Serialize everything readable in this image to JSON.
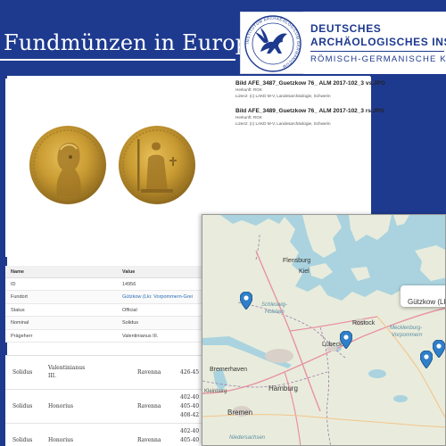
{
  "header": {
    "title": "Fundmünzen in Europa",
    "institute_line1": "DEUTSCHES",
    "institute_line2": "ARCHÄOLOGISCHES INSTITUT",
    "institute_line3": "RÖMISCH-GERMANISCHE KO",
    "seal_text": "INSTITUTUM ARCHAEOLOGICUM GERMANICUM"
  },
  "colors": {
    "brand_blue": "#1e3a8f",
    "link_blue": "#2a6db5",
    "map_water": "#aad3df",
    "map_land": "#e9ecdc",
    "marker_blue": "#2f7fc9"
  },
  "images": [
    {
      "filename": "Bild AFE_3487_Guetzkow 76_ ALM 2017-102_3 vs.JPG",
      "herkunft": "Herkunft: RGK",
      "lizenz": "Lizenz: (c) LAKD M-V, Landesarchäologie, Schwerin"
    },
    {
      "filename": "Bild AFE_3489_Guetzkow 76_ ALM 2017-102_3 rs.JPG",
      "herkunft": "Herkunft: RGK",
      "lizenz": "Lizenz: (c) LAKD M-V, Landesarchäologie, Schwerin"
    }
  ],
  "attributes": {
    "col_name": "Name",
    "col_value": "Value",
    "rows": [
      {
        "key": "ID",
        "value": "14956"
      },
      {
        "key": "Fundort",
        "value": "Gützkow (Lkr. Vorpommern-Grei"
      },
      {
        "key": "Status",
        "value": "Official"
      },
      {
        "key": "Nominal",
        "value": "Solidus"
      },
      {
        "key": "Prägeherr",
        "value": "Valentinianus III."
      }
    ]
  },
  "finds": [
    {
      "nominal": "Solidus",
      "ruler_1": "Valentinianus",
      "ruler_2": "III.",
      "mint": "Ravenna",
      "dates": [
        "426-45"
      ]
    },
    {
      "nominal": "Solidus",
      "ruler_1": "Honorius",
      "ruler_2": "",
      "mint": "Ravenna",
      "dates": [
        "402-40",
        "405-40",
        "408-42"
      ]
    },
    {
      "nominal": "Solidus",
      "ruler_1": "Honorius",
      "ruler_2": "",
      "mint": "Ravenna",
      "dates": [
        "402-40",
        "405-40"
      ]
    }
  ],
  "map": {
    "popup_label": "Gützkow (Lkr.",
    "labels": {
      "flensburg": "Flensburg",
      "kiel": "Kiel",
      "schleswig": "Schleswig-",
      "holstein": "Holstein",
      "rostock": "Rostock",
      "luebeck": "Lübeck",
      "mecklenburg": "Mecklenburg-",
      "vorpommern": "Vorpommern",
      "hamburg": "Hamburg",
      "bremerhaven": "Bremerhaven",
      "bremen": "Bremen",
      "niedersachsen": "Niedersachsen",
      "kleinburg": "Kleinburg"
    },
    "markers": [
      "marker-west-coast",
      "marker-luebeck",
      "marker-east-1",
      "marker-east-2",
      "marker-guetzkow"
    ]
  }
}
